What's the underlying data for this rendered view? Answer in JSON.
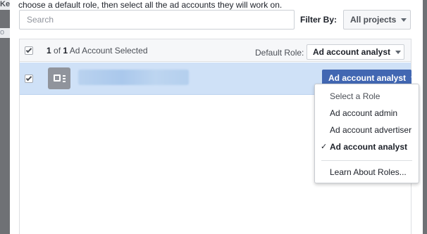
{
  "background": {
    "hints": [
      "Ke",
      "o"
    ]
  },
  "dialog": {
    "instruction": "choose a default role, then select all the ad accounts they will work on.",
    "search": {
      "placeholder": "Search",
      "value": ""
    },
    "filter": {
      "label": "Filter By:",
      "value": "All projects"
    },
    "table": {
      "header": {
        "selected_count": "1",
        "of_text": "of",
        "total_count": "1",
        "selected_suffix": "Ad Account Selected",
        "default_role_label": "Default Role:",
        "default_role_value": "Ad account analyst",
        "checkbox_checked": true
      },
      "rows": [
        {
          "account_name_redacted": true,
          "role": "Ad account analyst",
          "checked": true
        }
      ]
    },
    "role_menu": {
      "header": "Select a Role",
      "items": [
        {
          "label": "Ad account admin",
          "selected": false
        },
        {
          "label": "Ad account advertiser",
          "selected": false
        },
        {
          "label": "Ad account analyst",
          "selected": true
        }
      ],
      "check_glyph": "✓",
      "footer_link": "Learn About Roles..."
    }
  },
  "colors": {
    "accent": "#4267b2",
    "row_selected": "#cfe1f7",
    "overlay": "#6d6f73"
  }
}
